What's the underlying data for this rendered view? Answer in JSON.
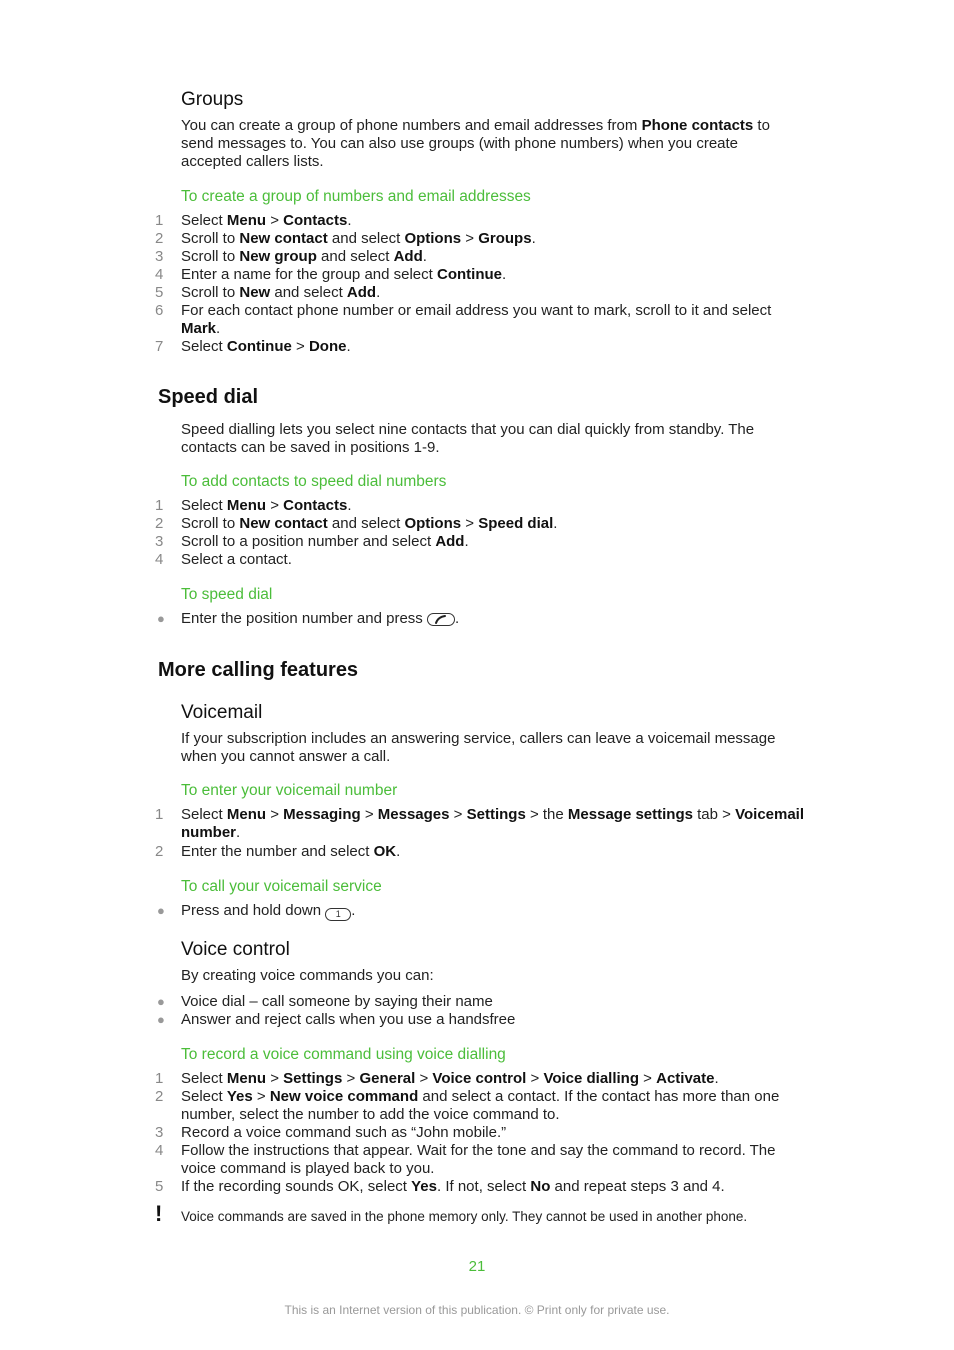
{
  "groups": {
    "heading": "Groups",
    "intro_1": "You can create a group of phone numbers and email addresses from ",
    "intro_bold": "Phone contacts",
    "intro_2": " to send messages to. You can also use groups (with phone numbers) when you create accepted callers lists.",
    "task_title": "To create a group of numbers and email addresses",
    "steps": [
      {
        "n": "1",
        "parts": [
          [
            "Select ",
            false
          ],
          [
            "Menu",
            true
          ],
          [
            " > ",
            false
          ],
          [
            "Contacts",
            true
          ],
          [
            ".",
            false
          ]
        ]
      },
      {
        "n": "2",
        "parts": [
          [
            "Scroll to ",
            false
          ],
          [
            "New contact",
            true
          ],
          [
            " and select ",
            false
          ],
          [
            "Options",
            true
          ],
          [
            " > ",
            false
          ],
          [
            "Groups",
            true
          ],
          [
            ".",
            false
          ]
        ]
      },
      {
        "n": "3",
        "parts": [
          [
            "Scroll to ",
            false
          ],
          [
            "New group",
            true
          ],
          [
            " and select ",
            false
          ],
          [
            "Add",
            true
          ],
          [
            ".",
            false
          ]
        ]
      },
      {
        "n": "4",
        "parts": [
          [
            "Enter a name for the group and select ",
            false
          ],
          [
            "Continue",
            true
          ],
          [
            ".",
            false
          ]
        ]
      },
      {
        "n": "5",
        "parts": [
          [
            "Scroll to ",
            false
          ],
          [
            "New",
            true
          ],
          [
            " and select ",
            false
          ],
          [
            "Add",
            true
          ],
          [
            ".",
            false
          ]
        ]
      },
      {
        "n": "6",
        "parts": [
          [
            "For each contact phone number or email address you want to mark, scroll to it and select ",
            false
          ],
          [
            "Mark",
            true
          ],
          [
            ".",
            false
          ]
        ]
      },
      {
        "n": "7",
        "parts": [
          [
            "Select ",
            false
          ],
          [
            "Continue",
            true
          ],
          [
            " > ",
            false
          ],
          [
            "Done",
            true
          ],
          [
            ".",
            false
          ]
        ]
      }
    ]
  },
  "speed_dial": {
    "heading": "Speed dial",
    "intro": "Speed dialling lets you select nine contacts that you can dial quickly from standby. The contacts can be saved in positions 1-9.",
    "task_title": "To add contacts to speed dial numbers",
    "steps": [
      {
        "n": "1",
        "parts": [
          [
            "Select ",
            false
          ],
          [
            "Menu",
            true
          ],
          [
            " > ",
            false
          ],
          [
            "Contacts",
            true
          ],
          [
            ".",
            false
          ]
        ]
      },
      {
        "n": "2",
        "parts": [
          [
            "Scroll to ",
            false
          ],
          [
            "New contact",
            true
          ],
          [
            " and select ",
            false
          ],
          [
            "Options",
            true
          ],
          [
            " > ",
            false
          ],
          [
            "Speed dial",
            true
          ],
          [
            ".",
            false
          ]
        ]
      },
      {
        "n": "3",
        "parts": [
          [
            "Scroll to a position number and select ",
            false
          ],
          [
            "Add",
            true
          ],
          [
            ".",
            false
          ]
        ]
      },
      {
        "n": "4",
        "parts": [
          [
            "Select a contact.",
            false
          ]
        ]
      }
    ],
    "task2_title": "To speed dial",
    "bullet": "Enter the position number and press ",
    "bullet_end": ".",
    "call_key_icon": "call-key-icon"
  },
  "more_calling": {
    "heading": "More calling features",
    "voicemail": {
      "heading": "Voicemail",
      "intro": "If your subscription includes an answering service, callers can leave a voicemail message when you cannot answer a call.",
      "task_title": "To enter your voicemail number",
      "steps": [
        {
          "n": "1",
          "parts": [
            [
              "Select ",
              false
            ],
            [
              "Menu",
              true
            ],
            [
              " > ",
              false
            ],
            [
              "Messaging",
              true
            ],
            [
              " > ",
              false
            ],
            [
              "Messages",
              true
            ],
            [
              " > ",
              false
            ],
            [
              "Settings",
              true
            ],
            [
              " > the ",
              false
            ],
            [
              "Message settings",
              true
            ],
            [
              " tab > ",
              false
            ],
            [
              "Voicemail number",
              true
            ],
            [
              ".",
              false
            ]
          ]
        },
        {
          "n": "2",
          "parts": [
            [
              "Enter the number and select ",
              false
            ],
            [
              "OK",
              true
            ],
            [
              ".",
              false
            ]
          ]
        }
      ],
      "task2_title": "To call your voicemail service",
      "bullet": "Press and hold down ",
      "key_label": "1",
      "bullet_end": "."
    },
    "voice_control": {
      "heading": "Voice control",
      "intro": "By creating voice commands you can:",
      "bullets": [
        "Voice dial – call someone by saying their name",
        "Answer and reject calls when you use a handsfree"
      ],
      "task_title": "To record a voice command using voice dialling",
      "steps": [
        {
          "n": "1",
          "parts": [
            [
              "Select ",
              false
            ],
            [
              "Menu",
              true
            ],
            [
              " > ",
              false
            ],
            [
              "Settings",
              true
            ],
            [
              " > ",
              false
            ],
            [
              "General",
              true
            ],
            [
              " > ",
              false
            ],
            [
              "Voice control",
              true
            ],
            [
              " > ",
              false
            ],
            [
              "Voice dialling",
              true
            ],
            [
              " > ",
              false
            ],
            [
              "Activate",
              true
            ],
            [
              ".",
              false
            ]
          ]
        },
        {
          "n": "2",
          "parts": [
            [
              "Select ",
              false
            ],
            [
              "Yes",
              true
            ],
            [
              " > ",
              false
            ],
            [
              "New voice command",
              true
            ],
            [
              " and select a contact. If the contact has more than one number, select the number to add the voice command to.",
              false
            ]
          ]
        },
        {
          "n": "3",
          "parts": [
            [
              "Record a voice command such as “John mobile.”",
              false
            ]
          ]
        },
        {
          "n": "4",
          "parts": [
            [
              "Follow the instructions that appear. Wait for the tone and say the command to record. The voice command is played back to you.",
              false
            ]
          ]
        },
        {
          "n": "5",
          "parts": [
            [
              "If the recording sounds OK, select ",
              false
            ],
            [
              "Yes",
              true
            ],
            [
              ". If not, select ",
              false
            ],
            [
              "No",
              true
            ],
            [
              " and repeat steps 3 and 4.",
              false
            ]
          ]
        }
      ],
      "note": "Voice commands are saved in the phone memory only. They cannot be used in another phone."
    }
  },
  "page_number": "21",
  "footer": "This is an Internet version of this publication. © Print only for private use.",
  "colors": {
    "accent_green": "#4bbd3a",
    "footer_gray": "#999999"
  }
}
